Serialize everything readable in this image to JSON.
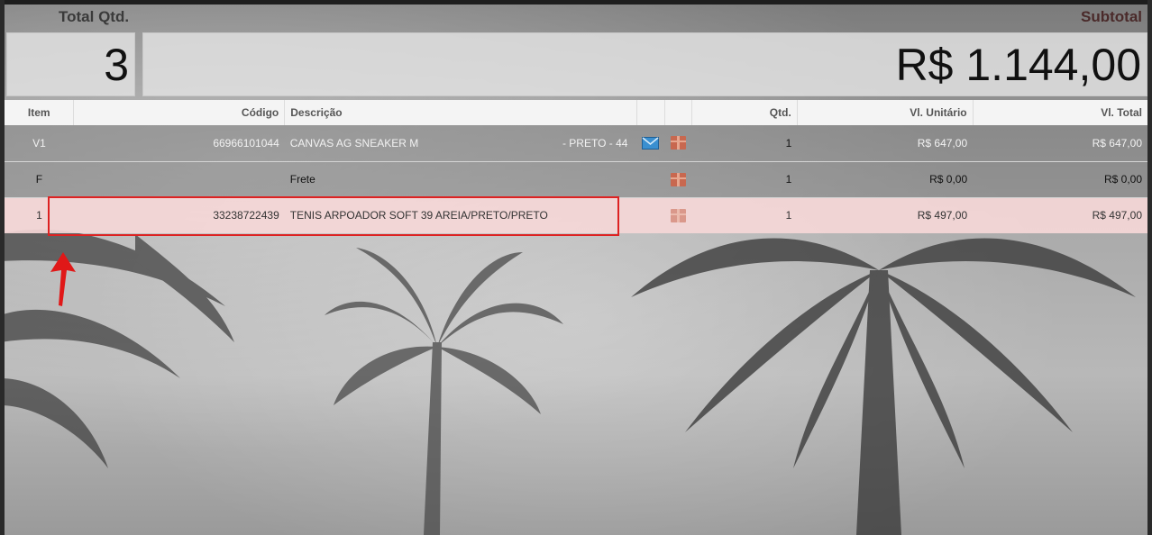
{
  "summary": {
    "total_qtd_label": "Total Qtd.",
    "total_qtd_value": "3",
    "subtotal_label": "Subtotal",
    "subtotal_value": "R$ 1.144,00"
  },
  "table": {
    "headers": {
      "item": "Item",
      "codigo": "Código",
      "descricao": "Descrição",
      "qtd": "Qtd.",
      "vl_unitario": "Vl. Unitário",
      "vl_total": "Vl. Total"
    },
    "rows": [
      {
        "item": "V1",
        "codigo": "66966101044",
        "descricao": "CANVAS AG SNEAKER M",
        "descricao_extra": "- PRETO - 44",
        "qtd": "1",
        "vl_unitario": "R$ 647,00",
        "vl_total": "R$ 647,00",
        "icons": [
          "mail-icon",
          "gift-icon"
        ]
      },
      {
        "item": "F",
        "codigo": "",
        "descricao": "Frete",
        "descricao_extra": "",
        "qtd": "1",
        "vl_unitario": "R$ 0,00",
        "vl_total": "R$ 0,00",
        "icons": [
          "gift-icon"
        ]
      },
      {
        "item": "1",
        "codigo": "33238722439",
        "descricao": "TENIS ARPOADOR SOFT 39 AREIA/PRETO/PRETO",
        "descricao_extra": "",
        "qtd": "1",
        "vl_unitario": "R$ 497,00",
        "vl_total": "R$ 497,00",
        "icons": [
          "gift-icon"
        ]
      }
    ]
  },
  "colors": {
    "highlight_border": "#dd2222",
    "selected_row": "#f5d7d7",
    "gift_icon": "#c8684f",
    "mail_icon": "#3a8fd0"
  }
}
